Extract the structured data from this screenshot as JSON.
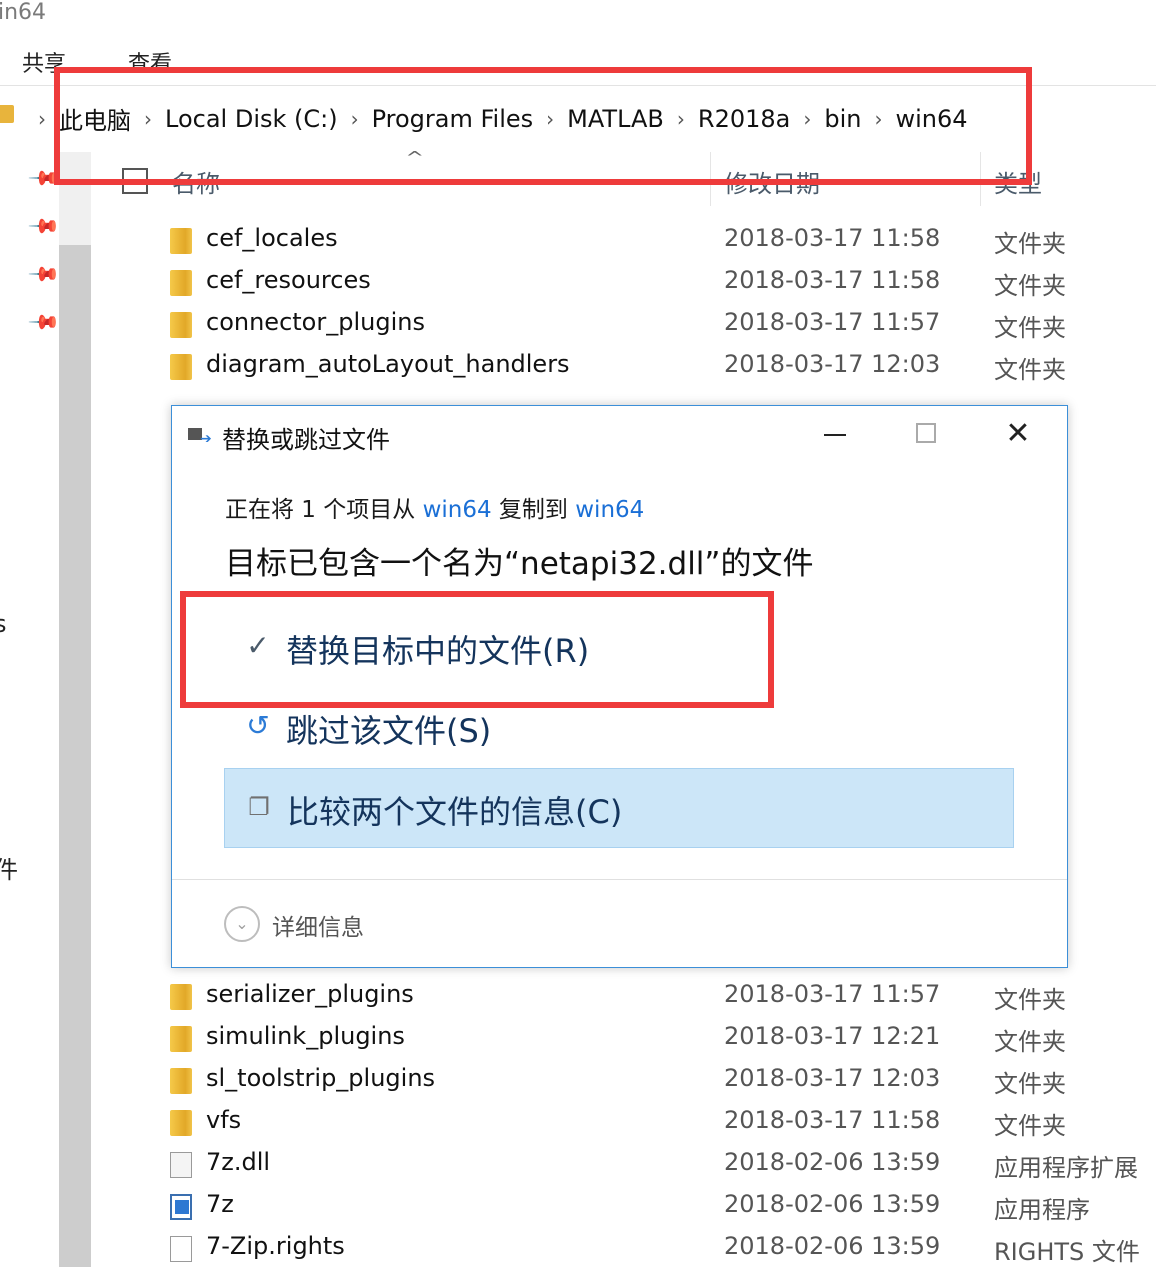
{
  "window": {
    "title_fragment": "in64"
  },
  "ribbon": {
    "tabs": [
      "共享",
      "查看"
    ]
  },
  "address": {
    "crumbs": [
      "此电脑",
      "Local Disk (C:)",
      "Program Files",
      "MATLAB",
      "R2018a",
      "bin",
      "win64"
    ]
  },
  "columns": {
    "name": "名称",
    "date": "修改日期",
    "type": "类型"
  },
  "left_pane_fragments": [
    "s",
    "件"
  ],
  "files_top": [
    {
      "name": "cef_locales",
      "date": "2018-03-17 11:58",
      "type": "文件夹",
      "icon": "folder-icon"
    },
    {
      "name": "cef_resources",
      "date": "2018-03-17 11:58",
      "type": "文件夹",
      "icon": "folder-icon"
    },
    {
      "name": "connector_plugins",
      "date": "2018-03-17 11:57",
      "type": "文件夹",
      "icon": "folder-icon"
    },
    {
      "name": "diagram_autoLayout_handlers",
      "date": "2018-03-17 12:03",
      "type": "文件夹",
      "icon": "folder-icon"
    }
  ],
  "files_bottom": [
    {
      "name": "serializer_plugins",
      "date": "2018-03-17 11:57",
      "type": "文件夹",
      "icon": "folder-icon"
    },
    {
      "name": "simulink_plugins",
      "date": "2018-03-17 12:21",
      "type": "文件夹",
      "icon": "folder-icon"
    },
    {
      "name": "sl_toolstrip_plugins",
      "date": "2018-03-17 12:03",
      "type": "文件夹",
      "icon": "folder-icon"
    },
    {
      "name": "vfs",
      "date": "2018-03-17 11:58",
      "type": "文件夹",
      "icon": "folder-icon"
    },
    {
      "name": "7z.dll",
      "date": "2018-02-06 13:59",
      "type": "应用程序扩展",
      "icon": "dll-icon"
    },
    {
      "name": "7z",
      "date": "2018-02-06 13:59",
      "type": "应用程序",
      "icon": "exe-icon"
    },
    {
      "name": "7-Zip.rights",
      "date": "2018-02-06 13:59",
      "type": "RIGHTS 文件",
      "icon": "doc-icon"
    }
  ],
  "dialog": {
    "title": "替换或跳过文件",
    "copy_prefix": "正在将 1 个项目从 ",
    "copy_source": "win64",
    "copy_middle": " 复制到 ",
    "copy_target": "win64",
    "headline": "目标已包含一个名为“netapi32.dll”的文件",
    "options": [
      {
        "label": "替换目标中的文件(R)",
        "icon": "checkmark-icon"
      },
      {
        "label": "跳过该文件(S)",
        "icon": "skip-arrow-icon"
      },
      {
        "label": "比较两个文件的信息(C)",
        "icon": "compare-files-icon"
      }
    ],
    "details_label": "详细信息",
    "controls": {
      "close_glyph": "✕"
    }
  },
  "colors": {
    "annotation_red": "#ee3b3b",
    "dialog_border": "#3c8fd8",
    "link_blue": "#1a6fd6",
    "option_text": "#14345c",
    "highlight_bg": "#cce6f8"
  }
}
